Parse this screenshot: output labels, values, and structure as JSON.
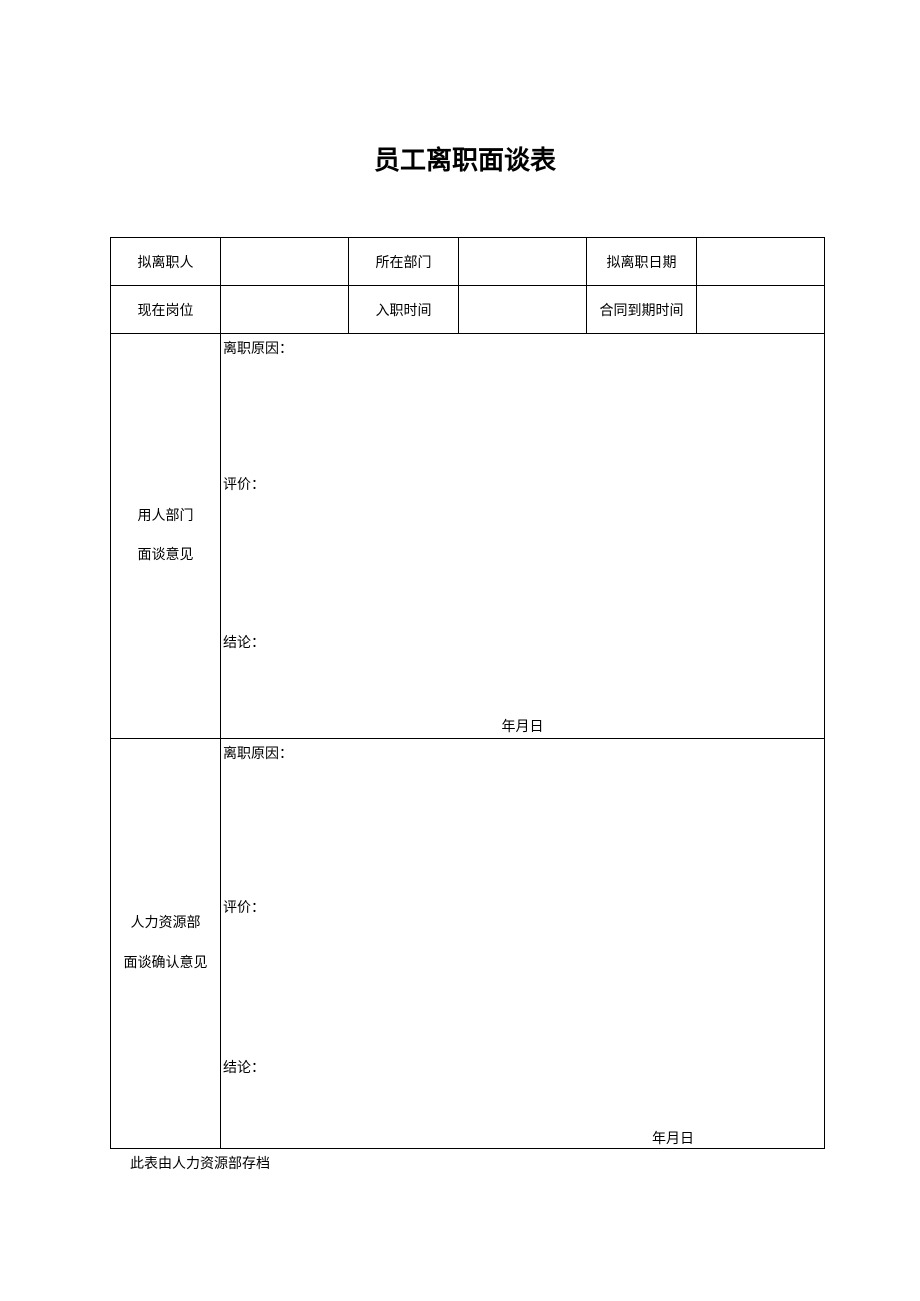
{
  "title": "员工离职面谈表",
  "row1": {
    "label1": "拟离职人",
    "value1": "",
    "label2": "所在部门",
    "value2": "",
    "label3": "拟离职日期",
    "value3": ""
  },
  "row2": {
    "label1": "现在岗位",
    "value1": "",
    "label2": "入职时间",
    "value2": "",
    "label3": "合同到期时间",
    "value3": ""
  },
  "section1": {
    "label_line1": "用人部门",
    "label_line2": "面谈意见",
    "reason_label": "离职原因：",
    "eval_label": "评价：",
    "concl_label": "结论：",
    "date_placeholder": "年月日"
  },
  "section2": {
    "label_line1": "人力资源部",
    "label_line2": "面谈确认意见",
    "reason_label": "离职原因：",
    "eval_label": "评价：",
    "concl_label": "结论：",
    "date_placeholder": "年月日"
  },
  "footer": "此表由人力资源部存档"
}
